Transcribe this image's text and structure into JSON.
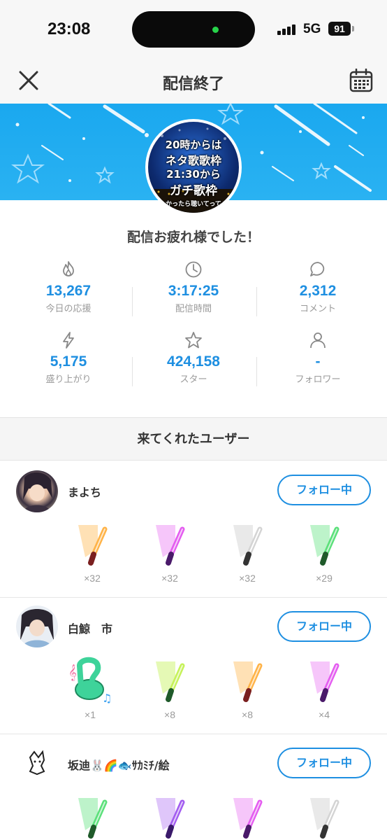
{
  "status_bar": {
    "time": "23:08",
    "network": "5G",
    "battery": "91"
  },
  "nav": {
    "title": "配信終了",
    "close_icon": "close-icon",
    "calendar_icon": "calendar-icon"
  },
  "banner": {
    "color": "#1aa8ef",
    "thumbnail_lines": [
      "20時からは",
      "ネタ歌歌枠",
      "21:30から",
      "ガチ歌枠",
      "かったら聴いてって"
    ]
  },
  "message": "配信お疲れ様でした！",
  "stats": [
    {
      "icon": "flame-icon",
      "value": "13,267",
      "label": "今日の応援"
    },
    {
      "icon": "clock-icon",
      "value": "3:17:25",
      "label": "配信時間"
    },
    {
      "icon": "comment-icon",
      "value": "2,312",
      "label": "コメント"
    },
    {
      "icon": "lightning-icon",
      "value": "5,175",
      "label": "盛り上がり"
    },
    {
      "icon": "star-icon",
      "value": "424,158",
      "label": "スター"
    },
    {
      "icon": "person-icon",
      "value": "-",
      "label": "フォロワー"
    }
  ],
  "section_title": "来てくれたユーザー",
  "accent_color": "#1e8fe1",
  "users": [
    {
      "name": "まよち",
      "follow_label": "フォロー中",
      "gifts": [
        {
          "icon": "glowstick-icon",
          "color": "#ffb347",
          "count": "×32"
        },
        {
          "icon": "glowstick-icon",
          "color": "#e45cf0",
          "count": "×32"
        },
        {
          "icon": "glowstick-icon",
          "color": "#d4d4d4",
          "count": "×32"
        },
        {
          "icon": "glowstick-icon",
          "color": "#5be07a",
          "count": "×29"
        }
      ]
    },
    {
      "name": "白鯨　市",
      "follow_label": "フォロー中",
      "gifts": [
        {
          "icon": "music-note-icon",
          "color": "#3ed39a",
          "count": "×1"
        },
        {
          "icon": "glowstick-icon",
          "color": "#c6f25a",
          "count": "×8"
        },
        {
          "icon": "glowstick-icon",
          "color": "#ffb347",
          "count": "×8"
        },
        {
          "icon": "glowstick-icon",
          "color": "#e45cf0",
          "count": "×4"
        }
      ]
    },
    {
      "name": "坂迪🐰🌈🐟ｻｶﾐﾁ/絵",
      "follow_label": "フォロー中",
      "gifts": [
        {
          "icon": "glowstick-icon",
          "color": "#5be07a",
          "count": ""
        },
        {
          "icon": "glowstick-icon",
          "color": "#a25cf0",
          "count": ""
        },
        {
          "icon": "glowstick-icon",
          "color": "#e45cf0",
          "count": ""
        },
        {
          "icon": "glowstick-icon",
          "color": "#d4d4d4",
          "count": ""
        }
      ]
    }
  ]
}
